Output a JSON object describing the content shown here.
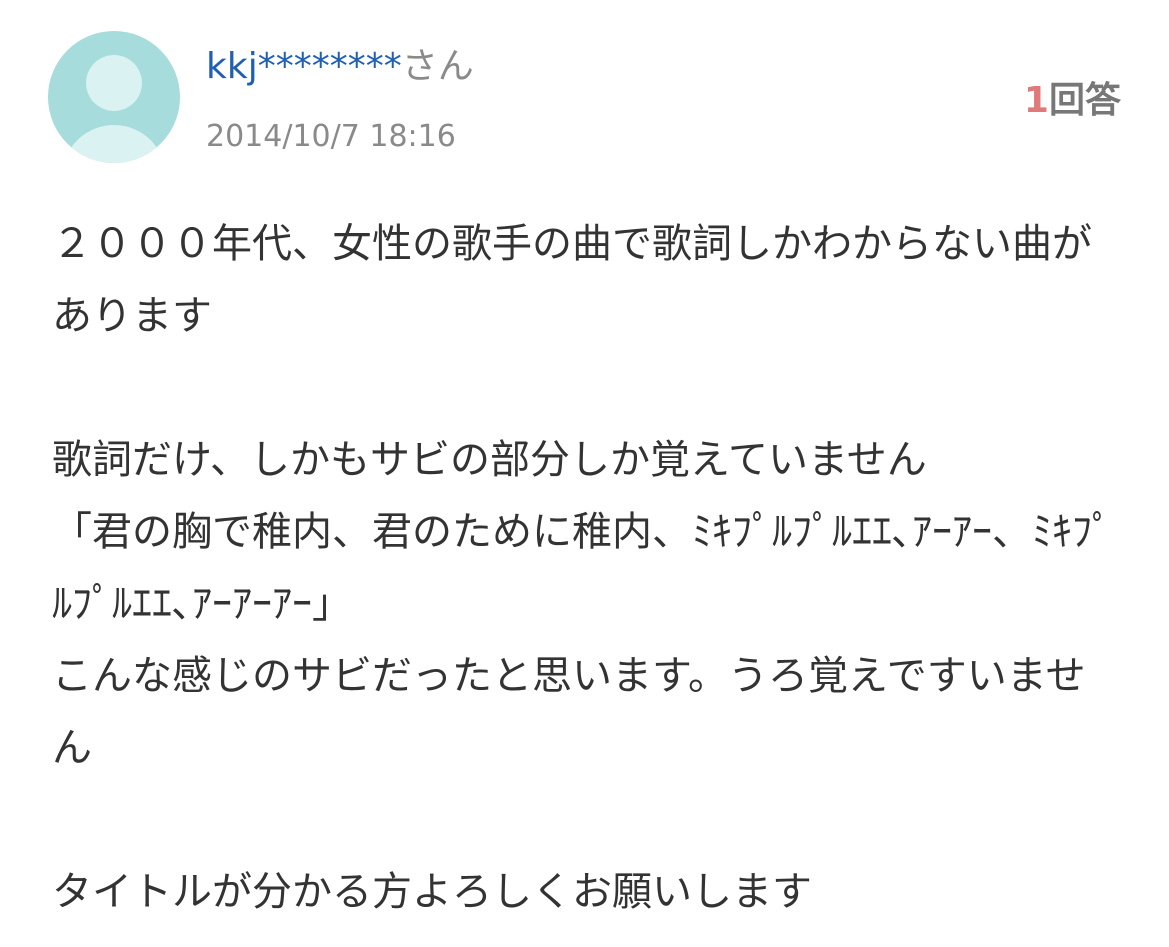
{
  "user": {
    "name": "kkj********",
    "suffix": "さん",
    "avatar_icon": "default-user-avatar-icon"
  },
  "post": {
    "date": "2014/10/7 18:16",
    "answer_count": "1",
    "answer_label": "回答"
  },
  "question": {
    "para1": "２０００年代、女性の歌手の曲で歌詞しかわからない曲があります",
    "para2_line1": "歌詞だけ、しかもサビの部分しか覚えていません",
    "para2_line2": "「君の胸で稚内、君のために稚内、ﾐｷﾌﾟﾙﾌﾟﾙｴｴ､ｱｰｱｰ、ﾐｷﾌﾟﾙﾌﾟﾙｴｴ､ｱｰｱｰｱｰ」",
    "para2_line3": "こんな感じのサビだったと思います。うろ覚えですいません",
    "para3": "タイトルが分かる方よろしくお願いします"
  },
  "colors": {
    "user_link": "#1f5fb5",
    "answer_count": "#e07a7a",
    "avatar_bg": "#a6dcdb",
    "avatar_fg": "#daf2f1"
  }
}
